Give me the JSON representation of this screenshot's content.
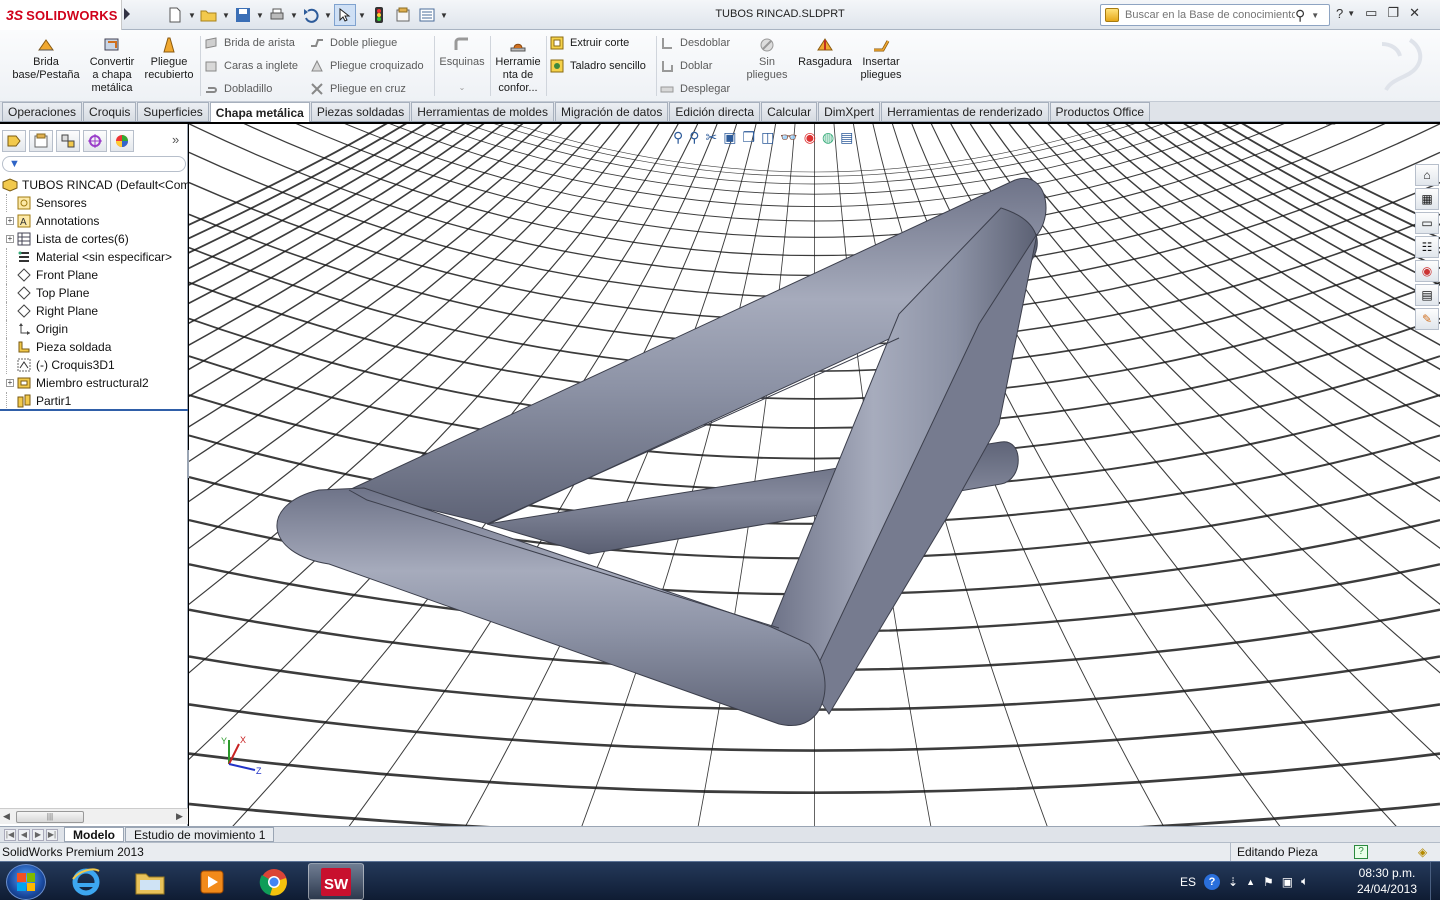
{
  "app": {
    "logo_prefix": "3S",
    "logo_text": "SOLIDWORKS",
    "document_title": "TUBOS RINCAD.SLDPRT"
  },
  "search": {
    "placeholder": "Buscar en la Base de conocimiento"
  },
  "ribbon": {
    "brida_base": "Brida base/Pestaña",
    "convertir": "Convertir a chapa metálica",
    "pliegue_recubierto": "Pliegue recubierto",
    "brida_arista": "Brida de arista",
    "caras_inglete": "Caras a inglete",
    "dobladillo": "Dobladillo",
    "doble_pliegue": "Doble pliegue",
    "pliegue_croquizado": "Pliegue croquizado",
    "pliegue_cruz": "Pliegue en cruz",
    "esquinas": "Esquinas",
    "herramienta": "Herramie nta de confor...",
    "extruir_corte": "Extruir corte",
    "taladro": "Taladro sencillo",
    "desdoblar": "Desdoblar",
    "doblar": "Doblar",
    "desplegar": "Desplegar",
    "sin_pliegues": "Sin pliegues",
    "rasgadura": "Rasgadura",
    "insertar_pliegues": "Insertar pliegues"
  },
  "tabs": [
    "Operaciones",
    "Croquis",
    "Superficies",
    "Chapa metálica",
    "Piezas soldadas",
    "Herramientas de moldes",
    "Migración de datos",
    "Edición directa",
    "Calcular",
    "DimXpert",
    "Herramientas de renderizado",
    "Productos Office"
  ],
  "active_tab": "Chapa metálica",
  "tree": {
    "root": "TUBOS RINCAD  (Default<Com",
    "items": [
      "Sensores",
      "Annotations",
      "Lista de cortes(6)",
      "Material <sin especificar>",
      "Front Plane",
      "Top Plane",
      "Right Plane",
      "Origin",
      "Pieza soldada",
      "(-) Croquis3D1",
      "Miembro estructural2",
      "Partir1"
    ]
  },
  "triad": {
    "y": "Y",
    "x": "X",
    "z": "Z"
  },
  "bottom_tabs": [
    "Modelo",
    "Estudio de movimiento 1"
  ],
  "status": {
    "product": "SolidWorks Premium 2013",
    "mode": "Editando Pieza"
  },
  "taskbar": {
    "language": "ES",
    "time": "08:30 p.m.",
    "date": "24/04/2013"
  },
  "colors": {
    "tube": "#8d93a6",
    "accent": "#2f5ea8",
    "brand_red": "#d0021b"
  }
}
